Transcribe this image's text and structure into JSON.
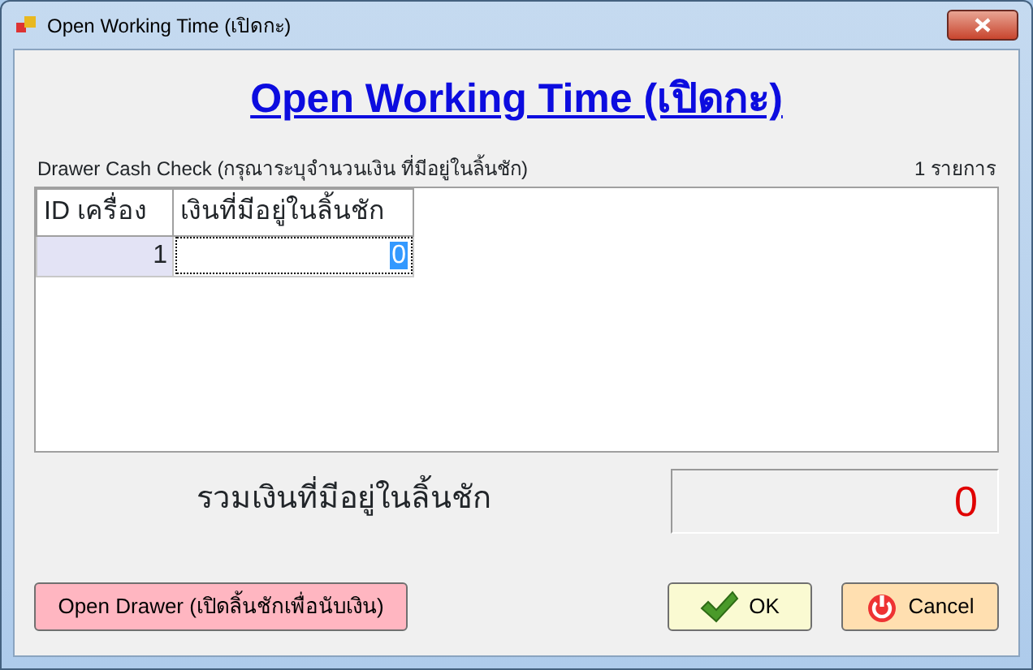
{
  "window": {
    "title": "Open Working Time (เปิดกะ)"
  },
  "heading": "Open Working Time (เปิดกะ)",
  "grid": {
    "label": "Drawer Cash Check (กรุณาระบุจำนวนเงิน ที่มีอยู่ในลิ้นชัก)",
    "count": "1 รายการ",
    "columns": [
      "ID เครื่อง",
      "เงินที่มีอยู่ในลิ้นชัก"
    ],
    "rows": [
      {
        "cells": [
          "1",
          "0"
        ],
        "selected": false
      }
    ]
  },
  "total": {
    "label": "รวมเงินที่มีอยู่ในลิ้นชัก",
    "value": "0"
  },
  "buttons": [
    {
      "kind": "drawer",
      "label": "Open Drawer (เปิดลิ้นชักเพื่อนับเงิน)"
    },
    {
      "kind": "ok",
      "label": "OK"
    },
    {
      "kind": "cancel",
      "label": "Cancel"
    }
  ]
}
